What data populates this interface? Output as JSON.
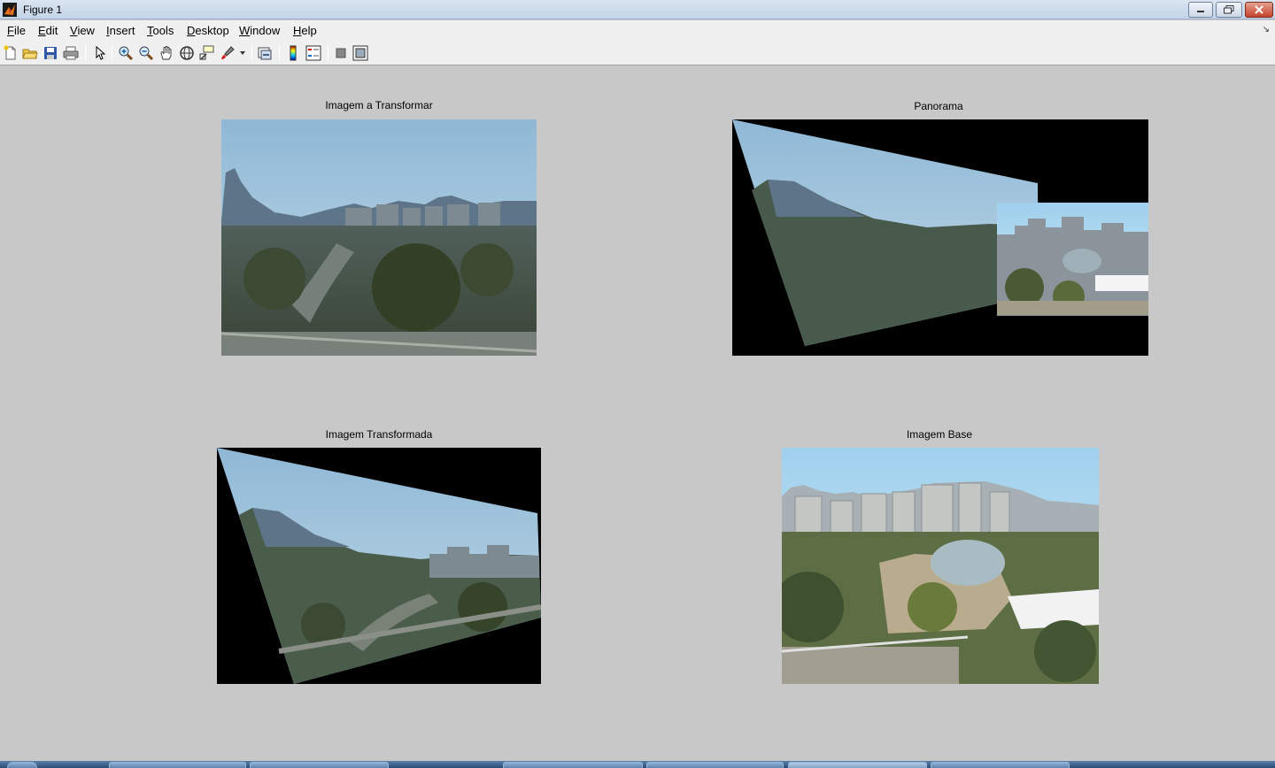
{
  "window": {
    "title": "Figure 1"
  },
  "menu": {
    "items": [
      {
        "label": "File",
        "u": "F",
        "rest": "ile"
      },
      {
        "label": "Edit",
        "u": "E",
        "rest": "dit"
      },
      {
        "label": "View",
        "u": "V",
        "rest": "iew"
      },
      {
        "label": "Insert",
        "u": "I",
        "rest": "nsert"
      },
      {
        "label": "Tools",
        "u": "T",
        "rest": "ools"
      },
      {
        "label": "Desktop",
        "u": "D",
        "rest": "esktop"
      },
      {
        "label": "Window",
        "u": "W",
        "rest": "indow"
      },
      {
        "label": "Help",
        "u": "H",
        "rest": "elp"
      }
    ]
  },
  "toolbar": {
    "icons": [
      "new-figure-icon",
      "open-file-icon",
      "save-icon",
      "print-icon",
      "edit-plot-icon",
      "zoom-in-icon",
      "zoom-out-icon",
      "pan-icon",
      "rotate-3d-icon",
      "data-cursor-icon",
      "brush-icon",
      "link-plot-icon",
      "colorbar-icon",
      "legend-icon",
      "hide-plot-tools-icon",
      "show-plot-tools-icon"
    ]
  },
  "axes": {
    "top_left": {
      "title": "Imagem a Transformar"
    },
    "top_right": {
      "title": "Panorama"
    },
    "bottom_left": {
      "title": "Imagem Transformada"
    },
    "bottom_right": {
      "title": "Imagem Base"
    }
  },
  "colors": {
    "figure_bg": "#c8c8c8",
    "image_bg": "#000000",
    "sky": "#9fc6e0"
  }
}
